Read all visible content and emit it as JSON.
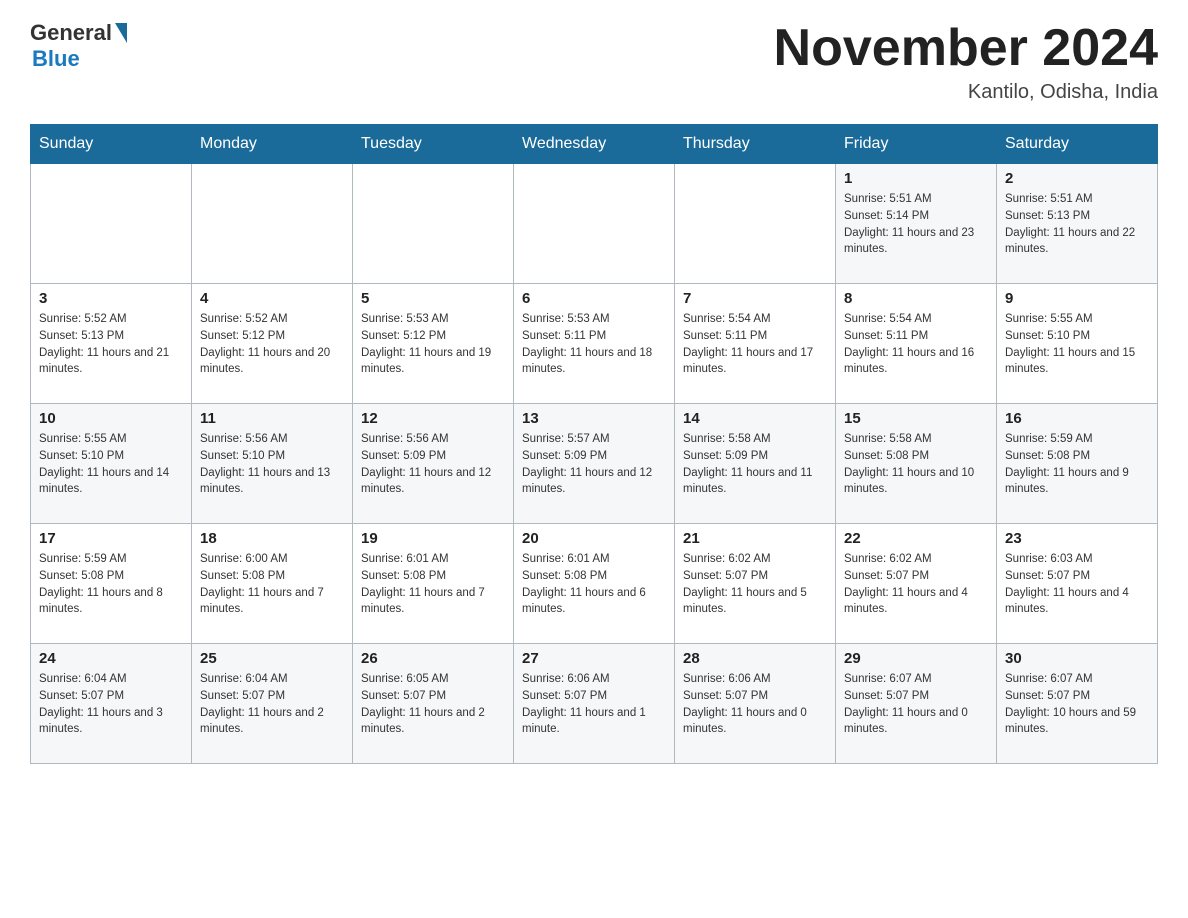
{
  "header": {
    "logo_general": "General",
    "logo_blue": "Blue",
    "month_title": "November 2024",
    "location": "Kantilo, Odisha, India"
  },
  "days_of_week": [
    "Sunday",
    "Monday",
    "Tuesday",
    "Wednesday",
    "Thursday",
    "Friday",
    "Saturday"
  ],
  "weeks": [
    [
      {
        "day": "",
        "sunrise": "",
        "sunset": "",
        "daylight": ""
      },
      {
        "day": "",
        "sunrise": "",
        "sunset": "",
        "daylight": ""
      },
      {
        "day": "",
        "sunrise": "",
        "sunset": "",
        "daylight": ""
      },
      {
        "day": "",
        "sunrise": "",
        "sunset": "",
        "daylight": ""
      },
      {
        "day": "",
        "sunrise": "",
        "sunset": "",
        "daylight": ""
      },
      {
        "day": "1",
        "sunrise": "Sunrise: 5:51 AM",
        "sunset": "Sunset: 5:14 PM",
        "daylight": "Daylight: 11 hours and 23 minutes."
      },
      {
        "day": "2",
        "sunrise": "Sunrise: 5:51 AM",
        "sunset": "Sunset: 5:13 PM",
        "daylight": "Daylight: 11 hours and 22 minutes."
      }
    ],
    [
      {
        "day": "3",
        "sunrise": "Sunrise: 5:52 AM",
        "sunset": "Sunset: 5:13 PM",
        "daylight": "Daylight: 11 hours and 21 minutes."
      },
      {
        "day": "4",
        "sunrise": "Sunrise: 5:52 AM",
        "sunset": "Sunset: 5:12 PM",
        "daylight": "Daylight: 11 hours and 20 minutes."
      },
      {
        "day": "5",
        "sunrise": "Sunrise: 5:53 AM",
        "sunset": "Sunset: 5:12 PM",
        "daylight": "Daylight: 11 hours and 19 minutes."
      },
      {
        "day": "6",
        "sunrise": "Sunrise: 5:53 AM",
        "sunset": "Sunset: 5:11 PM",
        "daylight": "Daylight: 11 hours and 18 minutes."
      },
      {
        "day": "7",
        "sunrise": "Sunrise: 5:54 AM",
        "sunset": "Sunset: 5:11 PM",
        "daylight": "Daylight: 11 hours and 17 minutes."
      },
      {
        "day": "8",
        "sunrise": "Sunrise: 5:54 AM",
        "sunset": "Sunset: 5:11 PM",
        "daylight": "Daylight: 11 hours and 16 minutes."
      },
      {
        "day": "9",
        "sunrise": "Sunrise: 5:55 AM",
        "sunset": "Sunset: 5:10 PM",
        "daylight": "Daylight: 11 hours and 15 minutes."
      }
    ],
    [
      {
        "day": "10",
        "sunrise": "Sunrise: 5:55 AM",
        "sunset": "Sunset: 5:10 PM",
        "daylight": "Daylight: 11 hours and 14 minutes."
      },
      {
        "day": "11",
        "sunrise": "Sunrise: 5:56 AM",
        "sunset": "Sunset: 5:10 PM",
        "daylight": "Daylight: 11 hours and 13 minutes."
      },
      {
        "day": "12",
        "sunrise": "Sunrise: 5:56 AM",
        "sunset": "Sunset: 5:09 PM",
        "daylight": "Daylight: 11 hours and 12 minutes."
      },
      {
        "day": "13",
        "sunrise": "Sunrise: 5:57 AM",
        "sunset": "Sunset: 5:09 PM",
        "daylight": "Daylight: 11 hours and 12 minutes."
      },
      {
        "day": "14",
        "sunrise": "Sunrise: 5:58 AM",
        "sunset": "Sunset: 5:09 PM",
        "daylight": "Daylight: 11 hours and 11 minutes."
      },
      {
        "day": "15",
        "sunrise": "Sunrise: 5:58 AM",
        "sunset": "Sunset: 5:08 PM",
        "daylight": "Daylight: 11 hours and 10 minutes."
      },
      {
        "day": "16",
        "sunrise": "Sunrise: 5:59 AM",
        "sunset": "Sunset: 5:08 PM",
        "daylight": "Daylight: 11 hours and 9 minutes."
      }
    ],
    [
      {
        "day": "17",
        "sunrise": "Sunrise: 5:59 AM",
        "sunset": "Sunset: 5:08 PM",
        "daylight": "Daylight: 11 hours and 8 minutes."
      },
      {
        "day": "18",
        "sunrise": "Sunrise: 6:00 AM",
        "sunset": "Sunset: 5:08 PM",
        "daylight": "Daylight: 11 hours and 7 minutes."
      },
      {
        "day": "19",
        "sunrise": "Sunrise: 6:01 AM",
        "sunset": "Sunset: 5:08 PM",
        "daylight": "Daylight: 11 hours and 7 minutes."
      },
      {
        "day": "20",
        "sunrise": "Sunrise: 6:01 AM",
        "sunset": "Sunset: 5:08 PM",
        "daylight": "Daylight: 11 hours and 6 minutes."
      },
      {
        "day": "21",
        "sunrise": "Sunrise: 6:02 AM",
        "sunset": "Sunset: 5:07 PM",
        "daylight": "Daylight: 11 hours and 5 minutes."
      },
      {
        "day": "22",
        "sunrise": "Sunrise: 6:02 AM",
        "sunset": "Sunset: 5:07 PM",
        "daylight": "Daylight: 11 hours and 4 minutes."
      },
      {
        "day": "23",
        "sunrise": "Sunrise: 6:03 AM",
        "sunset": "Sunset: 5:07 PM",
        "daylight": "Daylight: 11 hours and 4 minutes."
      }
    ],
    [
      {
        "day": "24",
        "sunrise": "Sunrise: 6:04 AM",
        "sunset": "Sunset: 5:07 PM",
        "daylight": "Daylight: 11 hours and 3 minutes."
      },
      {
        "day": "25",
        "sunrise": "Sunrise: 6:04 AM",
        "sunset": "Sunset: 5:07 PM",
        "daylight": "Daylight: 11 hours and 2 minutes."
      },
      {
        "day": "26",
        "sunrise": "Sunrise: 6:05 AM",
        "sunset": "Sunset: 5:07 PM",
        "daylight": "Daylight: 11 hours and 2 minutes."
      },
      {
        "day": "27",
        "sunrise": "Sunrise: 6:06 AM",
        "sunset": "Sunset: 5:07 PM",
        "daylight": "Daylight: 11 hours and 1 minute."
      },
      {
        "day": "28",
        "sunrise": "Sunrise: 6:06 AM",
        "sunset": "Sunset: 5:07 PM",
        "daylight": "Daylight: 11 hours and 0 minutes."
      },
      {
        "day": "29",
        "sunrise": "Sunrise: 6:07 AM",
        "sunset": "Sunset: 5:07 PM",
        "daylight": "Daylight: 11 hours and 0 minutes."
      },
      {
        "day": "30",
        "sunrise": "Sunrise: 6:07 AM",
        "sunset": "Sunset: 5:07 PM",
        "daylight": "Daylight: 10 hours and 59 minutes."
      }
    ]
  ]
}
